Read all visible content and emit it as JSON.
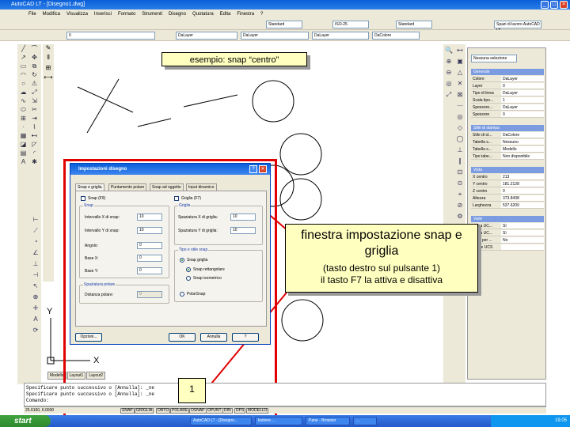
{
  "window": {
    "title": "AutoCAD LT - [Disegno1.dwg]"
  },
  "menu": [
    "File",
    "Modifica",
    "Visualizza",
    "Inserisci",
    "Formato",
    "Strumenti",
    "Disegno",
    "Quotatura",
    "Edita",
    "Finestra",
    "?"
  ],
  "toolbar1": {
    "style_combo": "Standard",
    "dim_combo": "ISO-25",
    "table_combo": "Standard",
    "workspace_combo": "Spazi di lavoro AutoCAD LT"
  },
  "toolbar2": {
    "layer_combo": "0",
    "color_combo": "DaLayer",
    "linetype_combo": "DaLayer",
    "lineweight_combo": "DaLayer",
    "plot_combo": "DaColore"
  },
  "properties": {
    "selector": "Nessuna selezione",
    "sections": [
      {
        "title": "Generale",
        "rows": [
          [
            "Colore",
            "DaLayer"
          ],
          [
            "Layer",
            "0"
          ],
          [
            "Tipo di linea",
            "DaLayer"
          ],
          [
            "Scala tipo...",
            "1"
          ],
          [
            "Spessore...",
            "DaLayer"
          ],
          [
            "Spessore",
            "0"
          ]
        ]
      },
      {
        "title": "Stile di stampa",
        "rows": [
          [
            "Stile di st...",
            "DaColore"
          ],
          [
            "Tabella s...",
            "Nessuno"
          ],
          [
            "Tabella s...",
            "Modello"
          ],
          [
            "Tipo tabe...",
            "Non disponibile"
          ]
        ]
      },
      {
        "title": "Vista",
        "rows": [
          [
            "X centro",
            "213"
          ],
          [
            "Y centro",
            "181.2128"
          ],
          [
            "Z centro",
            "0"
          ],
          [
            "Altezza",
            "373.8438"
          ],
          [
            "Larghezza",
            "537.6200"
          ]
        ]
      },
      {
        "title": "Varie",
        "rows": [
          [
            "Icona UC...",
            "Sì"
          ],
          [
            "Icona UC...",
            "Sì"
          ],
          [
            "UCS per ...",
            "No"
          ],
          [
            "Nome UCS",
            ""
          ]
        ]
      }
    ]
  },
  "callouts": {
    "snap_centro": "esempio: snap “centro”",
    "finestra_title": "finestra impostazione snap e griglia",
    "finestra_line1": "(tasto destro sul pulsante 1)",
    "finestra_line2": "il tasto F7 la attiva e disattiva",
    "marker": "1"
  },
  "dialog": {
    "title": "Impostazioni disegno",
    "help": "?",
    "close": "✕",
    "tabs": [
      "Snap e griglia",
      "Puntamento polare",
      "Snap ad oggetto",
      "Input dinamico"
    ],
    "snap_checkbox": "Snap (F9)",
    "grid_checkbox": "Griglia (F7)",
    "snap_group": "Snap",
    "snap_x_label": "Intervallo X di snap:",
    "snap_x_value": "10",
    "snap_y_label": "Intervallo Y di snap:",
    "snap_y_value": "10",
    "angle_label": "Angolo:",
    "angle_value": "0",
    "base_x_label": "Base X:",
    "base_x_value": "0",
    "base_y_label": "Base Y:",
    "base_y_value": "0",
    "grid_group": "Griglia",
    "grid_x_label": "Spaziatura X di griglia:",
    "grid_x_value": "10",
    "grid_y_label": "Spaziatura Y di griglia:",
    "grid_y_value": "10",
    "polar_group": "Spaziatura polare",
    "polar_label": "Distanza polare:",
    "polar_value": "0",
    "type_group": "Tipo e stile snap",
    "type_grid": "Snap griglia",
    "type_rect": "Snap rettangolare",
    "type_iso": "Snap isometrico",
    "type_polar": "PolarSnap",
    "options_btn": "Opzioni...",
    "ok_btn": "OK",
    "cancel_btn": "Annulla",
    "help_btn": "?"
  },
  "layout_tabs": [
    "Modello",
    "Layout1",
    "Layout2"
  ],
  "axis_labels": {
    "y": "Y",
    "x": "X"
  },
  "command_lines": [
    "Specificare punto successivo o [Annulla]: _ne",
    "Specificare punto successivo o [Annulla]: _ne",
    "Comando:"
  ],
  "status": {
    "coords": "25.6160, 6.0000",
    "buttons": [
      "SNAP",
      "GRIGLIA",
      "ORTO",
      "POLARE",
      "OSNAP",
      "OPUNT",
      "DIN",
      "DPS",
      "MODELLO"
    ]
  },
  "taskbar": {
    "start": "start",
    "tasks": [
      "AutoCAD LT - [Disegno...",
      "lezione ...",
      "Pane - Browser",
      "..."
    ],
    "time": "19.05"
  }
}
